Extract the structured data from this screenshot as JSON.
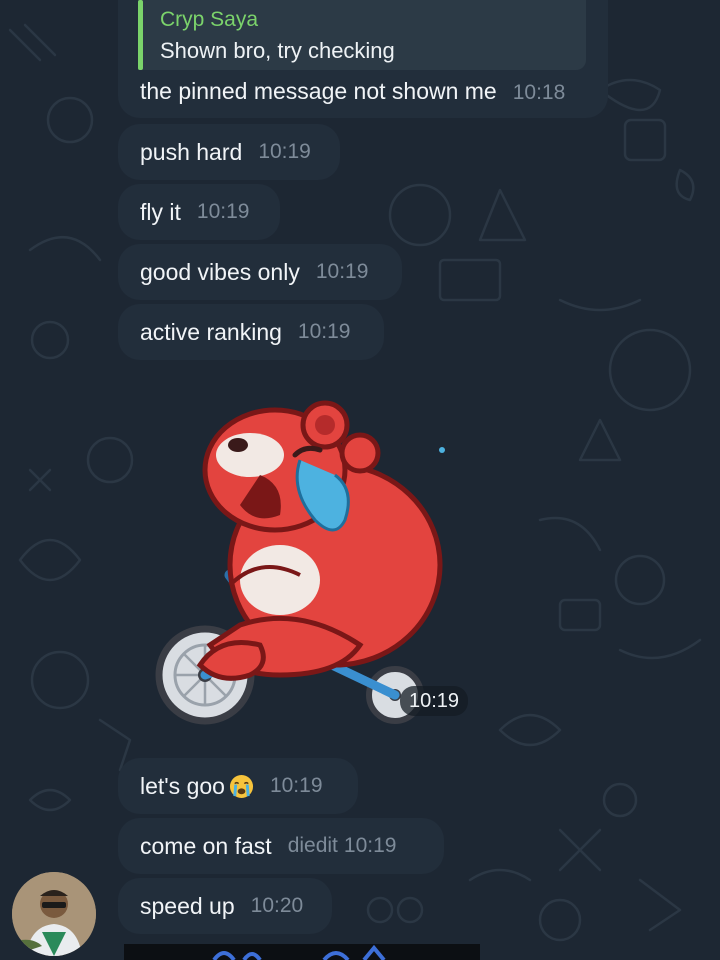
{
  "colors": {
    "background": "#1d2733",
    "bubble": "#222e3b",
    "reply_accent": "#7bd36b",
    "text": "#f1f4f7",
    "time": "#7e8b99"
  },
  "reply": {
    "author": "Cryp Saya",
    "quoted_text": "Shown bro, try checking"
  },
  "messages": [
    {
      "text": "the pinned message not shown me",
      "time": "10:18"
    },
    {
      "text": "push hard",
      "time": "10:19"
    },
    {
      "text": "fly it",
      "time": "10:19"
    },
    {
      "text": "good vibes only",
      "time": "10:19"
    },
    {
      "text": "active ranking",
      "time": "10:19"
    },
    {
      "text": "let's goo",
      "emoji": "loudly-crying-face-icon",
      "time": "10:19"
    },
    {
      "text": "come on fast",
      "edited": "diedit",
      "time": "10:19"
    },
    {
      "text": "speed up",
      "time": "10:20"
    }
  ],
  "sticker": {
    "icon": "bear-on-bicycle-sticker",
    "time": "10:19"
  }
}
